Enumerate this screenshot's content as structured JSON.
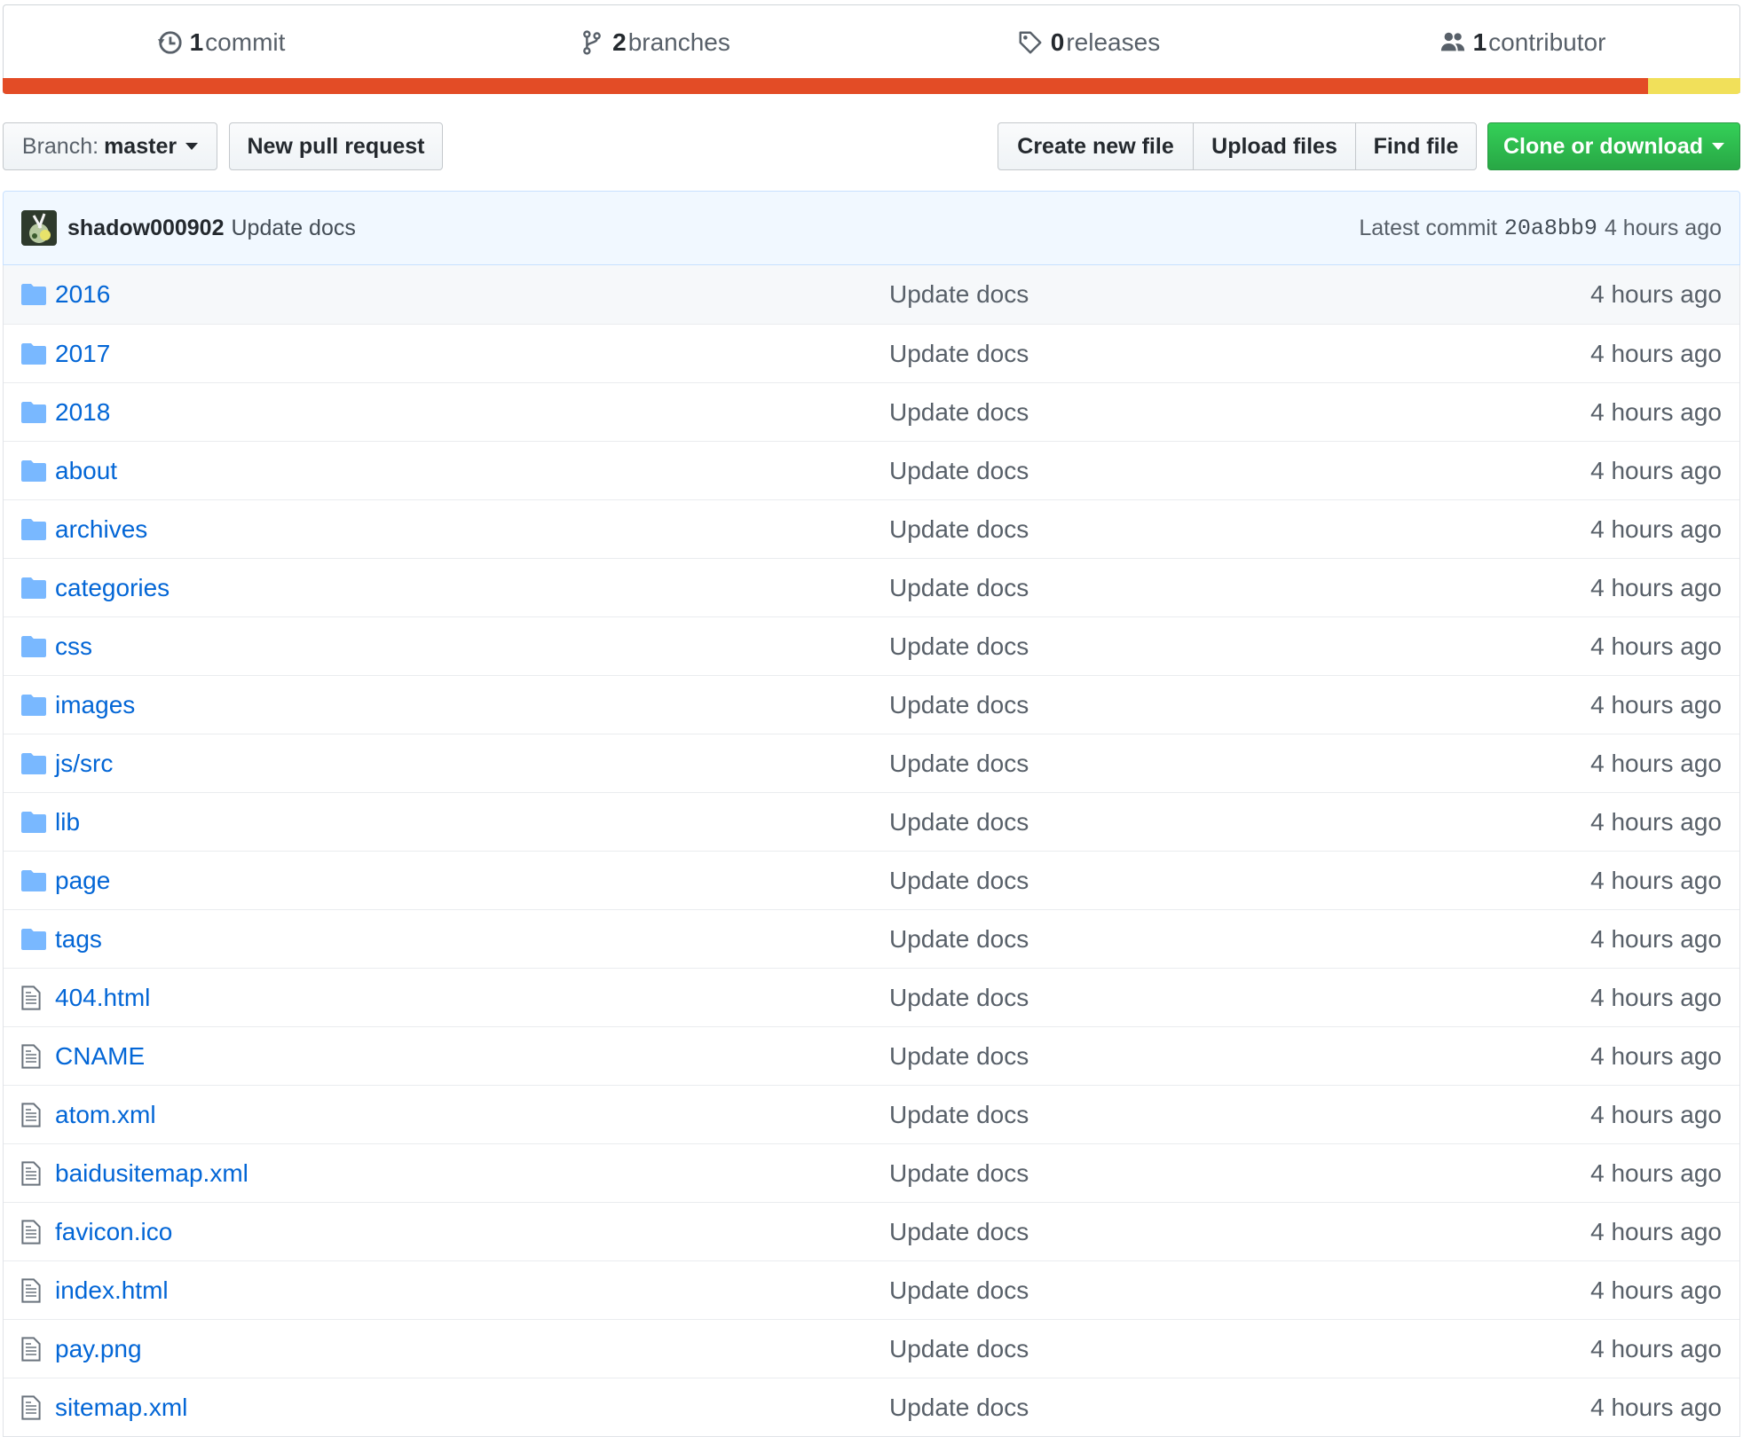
{
  "stats": {
    "commits": {
      "count": "1",
      "label": "commit",
      "icon": "history-icon"
    },
    "branches": {
      "count": "2",
      "label": "branches",
      "icon": "git-branch-icon"
    },
    "releases": {
      "count": "0",
      "label": "releases",
      "icon": "tag-icon"
    },
    "contributors": {
      "count": "1",
      "label": "contributor",
      "icon": "people-icon"
    }
  },
  "language_bar": [
    {
      "color": "#e34c26",
      "fraction": 0.947
    },
    {
      "color": "#f1e05a",
      "fraction": 0.053
    }
  ],
  "toolbar": {
    "branch_prefix": "Branch:",
    "branch_name": "master",
    "new_pull_request": "New pull request",
    "create_new_file": "Create new file",
    "upload_files": "Upload files",
    "find_file": "Find file",
    "clone_or_download": "Clone or download"
  },
  "latest_commit": {
    "author": "shadow000902",
    "message": "Update docs",
    "label": "Latest commit",
    "sha": "20a8bb9",
    "age": "4 hours ago"
  },
  "files": [
    {
      "name": "2016",
      "type": "directory",
      "message": "Update docs",
      "age": "4 hours ago"
    },
    {
      "name": "2017",
      "type": "directory",
      "message": "Update docs",
      "age": "4 hours ago"
    },
    {
      "name": "2018",
      "type": "directory",
      "message": "Update docs",
      "age": "4 hours ago"
    },
    {
      "name": "about",
      "type": "directory",
      "message": "Update docs",
      "age": "4 hours ago"
    },
    {
      "name": "archives",
      "type": "directory",
      "message": "Update docs",
      "age": "4 hours ago"
    },
    {
      "name": "categories",
      "type": "directory",
      "message": "Update docs",
      "age": "4 hours ago"
    },
    {
      "name": "css",
      "type": "directory",
      "message": "Update docs",
      "age": "4 hours ago"
    },
    {
      "name": "images",
      "type": "directory",
      "message": "Update docs",
      "age": "4 hours ago"
    },
    {
      "name": "js/src",
      "type": "directory",
      "message": "Update docs",
      "age": "4 hours ago"
    },
    {
      "name": "lib",
      "type": "directory",
      "message": "Update docs",
      "age": "4 hours ago"
    },
    {
      "name": "page",
      "type": "directory",
      "message": "Update docs",
      "age": "4 hours ago"
    },
    {
      "name": "tags",
      "type": "directory",
      "message": "Update docs",
      "age": "4 hours ago"
    },
    {
      "name": "404.html",
      "type": "file",
      "message": "Update docs",
      "age": "4 hours ago"
    },
    {
      "name": "CNAME",
      "type": "file",
      "message": "Update docs",
      "age": "4 hours ago"
    },
    {
      "name": "atom.xml",
      "type": "file",
      "message": "Update docs",
      "age": "4 hours ago"
    },
    {
      "name": "baidusitemap.xml",
      "type": "file",
      "message": "Update docs",
      "age": "4 hours ago"
    },
    {
      "name": "favicon.ico",
      "type": "file",
      "message": "Update docs",
      "age": "4 hours ago"
    },
    {
      "name": "index.html",
      "type": "file",
      "message": "Update docs",
      "age": "4 hours ago"
    },
    {
      "name": "pay.png",
      "type": "file",
      "message": "Update docs",
      "age": "4 hours ago"
    },
    {
      "name": "sitemap.xml",
      "type": "file",
      "message": "Update docs",
      "age": "4 hours ago"
    }
  ],
  "colors": {
    "link": "#0366d6",
    "folder_icon": "#79b8ff",
    "file_icon": "#6a737d",
    "clone_button": "#28a745",
    "commit_bar_bg": "#f1f8ff"
  }
}
